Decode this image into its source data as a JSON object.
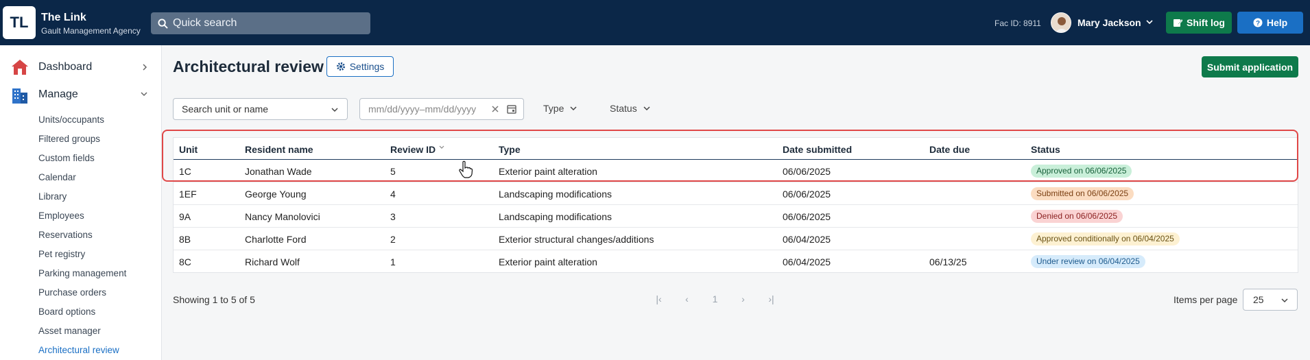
{
  "app": {
    "logo_text": "TL",
    "name": "The Link",
    "subtitle": "Gault Management Agency"
  },
  "header": {
    "search_label": "Quick search",
    "fac_id": "Fac ID: 8911",
    "user_name": "Mary Jackson",
    "shift_log_label": "Shift log",
    "help_label": "Help",
    "colors": {
      "bar": "#0b2748",
      "shift": "#0e7a4b",
      "help": "#1a6fc4"
    }
  },
  "sidebar": {
    "dashboard_label": "Dashboard",
    "manage_label": "Manage",
    "sub_items": [
      "Units/occupants",
      "Filtered groups",
      "Custom fields",
      "Calendar",
      "Library",
      "Employees",
      "Reservations",
      "Pet registry",
      "Parking management",
      "Purchase orders",
      "Board options",
      "Asset manager",
      "Architectural review"
    ],
    "active_item": "Architectural review"
  },
  "page": {
    "title": "Architectural review",
    "settings_label": "Settings",
    "submit_label": "Submit application"
  },
  "filters": {
    "unit_placeholder": "Search unit or name",
    "date_placeholder": "mm/dd/yyyy–mm/dd/yyyy",
    "type_label": "Type",
    "status_label": "Status"
  },
  "table": {
    "headers": [
      "Unit",
      "Resident name",
      "Review ID",
      "Type",
      "Date submitted",
      "Date due",
      "Status"
    ],
    "rows": [
      {
        "unit": "1C",
        "resident": "Jonathan Wade",
        "review_id": "5",
        "type": "Exterior paint alteration",
        "submitted": "06/06/2025",
        "due": "",
        "status": "Approved on 06/06/2025",
        "status_kind": "green"
      },
      {
        "unit": "1EF",
        "resident": "George Young",
        "review_id": "4",
        "type": "Landscaping modifications",
        "submitted": "06/06/2025",
        "due": "",
        "status": "Submitted on 06/06/2025",
        "status_kind": "orange"
      },
      {
        "unit": "9A",
        "resident": "Nancy Manolovici",
        "review_id": "3",
        "type": "Landscaping modifications",
        "submitted": "06/06/2025",
        "due": "",
        "status": "Denied on 06/06/2025",
        "status_kind": "red"
      },
      {
        "unit": "8B",
        "resident": "Charlotte Ford",
        "review_id": "2",
        "type": "Exterior structural changes/additions",
        "submitted": "06/04/2025",
        "due": "",
        "status": "Approved conditionally on 06/04/2025",
        "status_kind": "yellow"
      },
      {
        "unit": "8C",
        "resident": "Richard Wolf",
        "review_id": "1",
        "type": "Exterior paint alteration",
        "submitted": "06/04/2025",
        "due": "06/13/25",
        "status": "Under review on 06/04/2025",
        "status_kind": "blue"
      }
    ]
  },
  "footer": {
    "showing": "Showing 1 to 5 of 5",
    "current_page": "1",
    "items_per_page_label": "Items per page",
    "items_per_page_value": "25"
  }
}
